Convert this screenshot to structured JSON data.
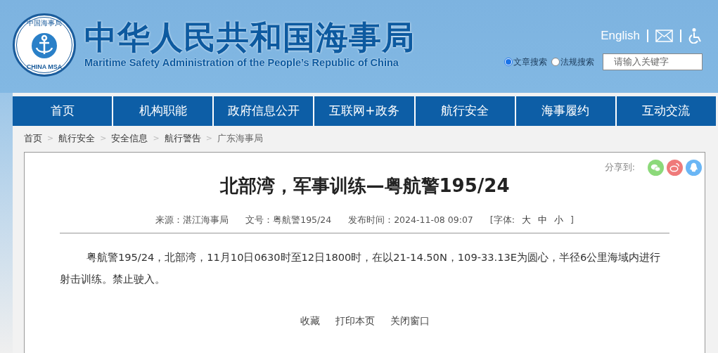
{
  "header": {
    "logo": {
      "top_text": "中国海事局",
      "bottom_text": "CHINA MSA"
    },
    "title": "中华人民共和国海事局",
    "subtitle": "Maritime Safety Administration of the People’s Republic of China",
    "language_link": "English",
    "search": {
      "options": [
        {
          "label": "文章搜索",
          "selected": true
        },
        {
          "label": "法规搜索",
          "selected": false
        }
      ],
      "placeholder": "请输入关键字"
    }
  },
  "nav": [
    {
      "label": "首页"
    },
    {
      "label": "机构职能"
    },
    {
      "label": "政府信息公开"
    },
    {
      "label": "互联网+政务"
    },
    {
      "label": "航行安全"
    },
    {
      "label": "海事履约"
    },
    {
      "label": "互动交流"
    }
  ],
  "breadcrumb_separator": ">",
  "breadcrumb": [
    {
      "label": "首页"
    },
    {
      "label": "航行安全"
    },
    {
      "label": "安全信息"
    },
    {
      "label": "航行警告"
    },
    {
      "label": "广东海事局"
    }
  ],
  "article": {
    "share_label": "分享到:",
    "share": [
      {
        "kind": "wechat",
        "color": "#8cd97a"
      },
      {
        "kind": "weibo",
        "color": "#ef7a7a"
      },
      {
        "kind": "qq",
        "color": "#6ab6f5"
      }
    ],
    "title": "北部湾，军事训练—粤航警195/24",
    "meta": [
      {
        "label": "来源：湛江海事局"
      },
      {
        "label": "文号：粤航警195/24"
      },
      {
        "label": "发布时间：2024-11-08 09:07"
      }
    ],
    "font_size": {
      "open": "[字体:",
      "sizes": [
        "大",
        "中",
        "小"
      ],
      "close": "]"
    },
    "body": "粤航警195/24，北部湾，11月10日0630时至12日1800时，在以21-14.50N，109-33.13E为圆心，半径6公里海域内进行射击训练。禁止驶入。",
    "actions": [
      "收藏",
      "打印本页",
      "关闭窗口"
    ]
  }
}
